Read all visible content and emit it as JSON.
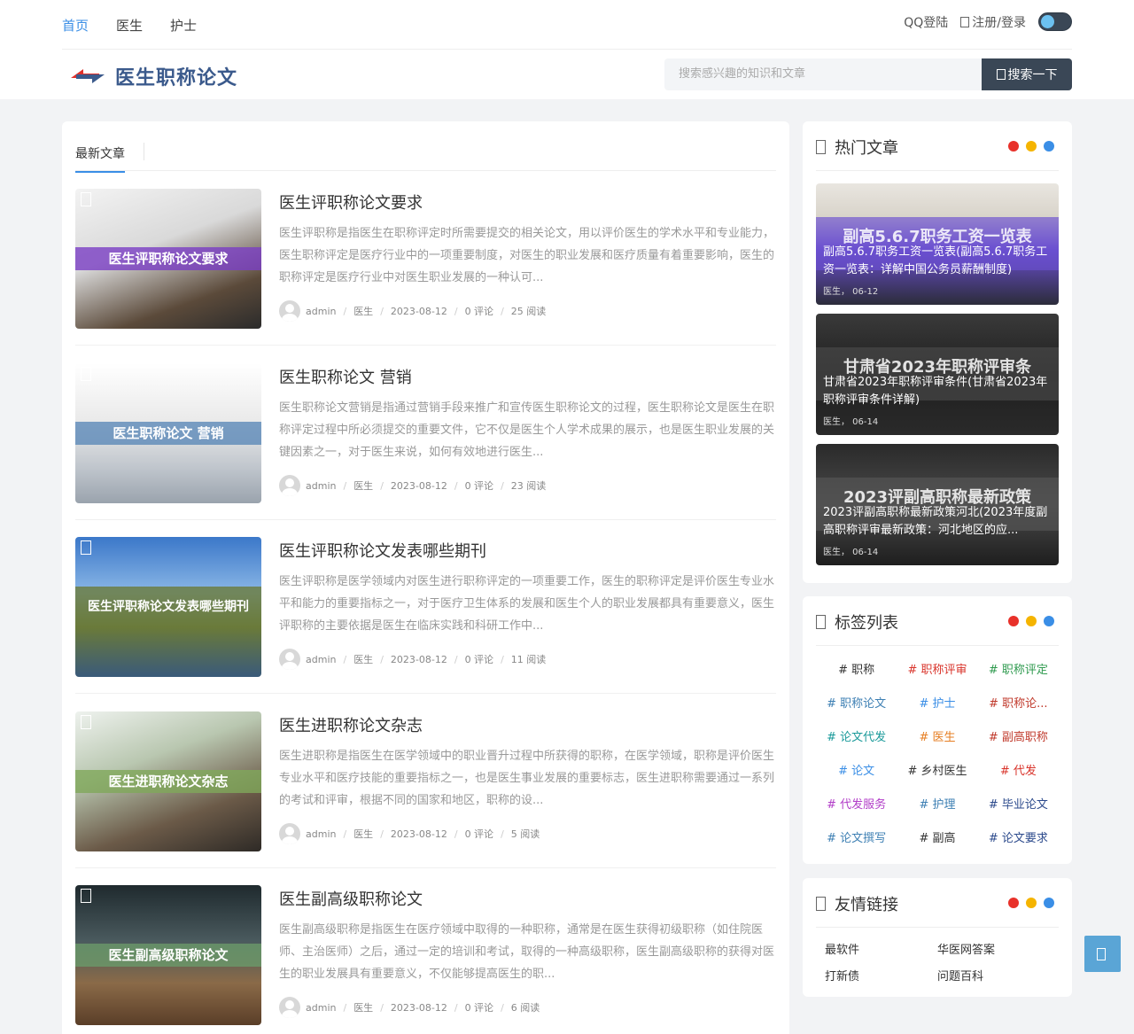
{
  "nav": {
    "links": [
      "首页",
      "医生",
      "护士"
    ],
    "qq_login": "QQ登陆",
    "register_login": "注册/登录"
  },
  "site": {
    "title": "医生职称论文"
  },
  "search": {
    "placeholder": "搜索感兴趣的知识和文章",
    "button": "搜索一下"
  },
  "main": {
    "tab": "最新文章",
    "posts": [
      {
        "title": "医生评职称论文要求",
        "thumb_text": "医生评职称论文要求",
        "excerpt": "医生评职称是指医生在职称评定时所需要提交的相关论文，用以评价医生的学术水平和专业能力，医生职称评定是医疗行业中的一项重要制度，对医生的职业发展和医疗质量有着重要影响，医生的职称评定是医疗行业中对医生职业发展的一种认可...",
        "author": "admin",
        "category": "医生",
        "date": "2023-08-12",
        "comments": "0 评论",
        "views": "25 阅读",
        "band_color": "#7a3fc4"
      },
      {
        "title": "医生职称论文 营销",
        "thumb_text": "医生职称论文 营销",
        "excerpt": "医生职称论文营销是指通过营销手段来推广和宣传医生职称论文的过程，医生职称论文是医生在职称评定过程中所必须提交的重要文件，它不仅是医生个人学术成果的展示，也是医生职业发展的关键因素之一，对于医生来说，如何有效地进行医生...",
        "author": "admin",
        "category": "医生",
        "date": "2023-08-12",
        "comments": "0 评论",
        "views": "23 阅读",
        "band_color": "#5b88b8"
      },
      {
        "title": "医生评职称论文发表哪些期刊",
        "thumb_text": "医生评职称论文发表哪些期刊",
        "excerpt": "医生评职称是医学领域内对医生进行职称评定的一项重要工作，医生的职称评定是评价医生专业水平和能力的重要指标之一，对于医疗卫生体系的发展和医生个人的职业发展都具有重要意义，医生评职称的主要依据是医生在临床实践和科研工作中...",
        "author": "admin",
        "category": "医生",
        "date": "2023-08-12",
        "comments": "0 评论",
        "views": "11 阅读",
        "band_color": "#6a7a3a"
      },
      {
        "title": "医生进职称论文杂志",
        "thumb_text": "医生进职称论文杂志",
        "excerpt": "医生进职称是指医生在医学领域中的职业晋升过程中所获得的职称，在医学领域，职称是评价医生专业水平和医疗技能的重要指标之一，也是医生事业发展的重要标志，医生进职称需要通过一系列的考试和评审，根据不同的国家和地区，职称的设...",
        "author": "admin",
        "category": "医生",
        "date": "2023-08-12",
        "comments": "0 评论",
        "views": "5 阅读",
        "band_color": "#7fa85a"
      },
      {
        "title": "医生副高级职称论文",
        "thumb_text": "医生副高级职称论文",
        "excerpt": "医生副高级职称是指医生在医疗领域中取得的一种职称，通常是在医生获得初级职称（如住院医师、主治医师）之后，通过一定的培训和考试，取得的一种高级职称，医生副高级职称的获得对医生的职业发展具有重要意义，不仅能够提高医生的职...",
        "author": "admin",
        "category": "医生",
        "date": "2023-08-12",
        "comments": "0 评论",
        "views": "6 阅读",
        "band_color": "#6a9a6a"
      }
    ]
  },
  "sidebar": {
    "hot": {
      "title": "热门文章",
      "items": [
        {
          "big": "副高5.6.7职务工资一览表",
          "caption": "副高5.6.7职务工资一览表(副高5.6.7职务工资一览表：详解中国公务员薪酬制度)",
          "meta": "医生， 06-12",
          "band_color": "#6a4fd0"
        },
        {
          "big": "甘肃省2023年职称评审条",
          "caption": "甘肃省2023年职称评审条件(甘肃省2023年职称评审条件详解)",
          "meta": "医生， 06-14",
          "band_color": "#4a4a4a"
        },
        {
          "big": "2023评副高职称最新政策",
          "caption": "2023评副高职称最新政策河北(2023年度副高职称评审最新政策：河北地区的应...",
          "meta": "医生， 06-14",
          "band_color": "#555555"
        }
      ]
    },
    "tags": {
      "title": "标签列表",
      "items": [
        {
          "label": "# 职称",
          "color": "#333333"
        },
        {
          "label": "# 职称评审",
          "color": "#d9342b"
        },
        {
          "label": "# 职称评定",
          "color": "#2e9a4e"
        },
        {
          "label": "# 职称论文",
          "color": "#3d7fb3"
        },
        {
          "label": "# 护士",
          "color": "#3a8ee6"
        },
        {
          "label": "# 职称论...",
          "color": "#c0392b"
        },
        {
          "label": "# 论文代发",
          "color": "#1a9a9a"
        },
        {
          "label": "# 医生",
          "color": "#e67e22"
        },
        {
          "label": "# 副高职称",
          "color": "#c0392b"
        },
        {
          "label": "# 论文",
          "color": "#3a8ee6"
        },
        {
          "label": "# 乡村医生",
          "color": "#333333"
        },
        {
          "label": "# 代发",
          "color": "#d9342b"
        },
        {
          "label": "# 代发服务",
          "color": "#b23ec8"
        },
        {
          "label": "# 护理",
          "color": "#3d7fb3"
        },
        {
          "label": "# 毕业论文",
          "color": "#2c4a8c"
        },
        {
          "label": "# 论文撰写",
          "color": "#3d7fb3"
        },
        {
          "label": "# 副高",
          "color": "#333333"
        },
        {
          "label": "# 论文要求",
          "color": "#2c4a8c"
        }
      ]
    },
    "links": {
      "title": "友情链接",
      "items": [
        "最软件",
        "华医网答案",
        "打新债",
        "问题百科"
      ]
    },
    "dot_colors": [
      "#e8312a",
      "#f5b400",
      "#3a8ee6"
    ]
  }
}
